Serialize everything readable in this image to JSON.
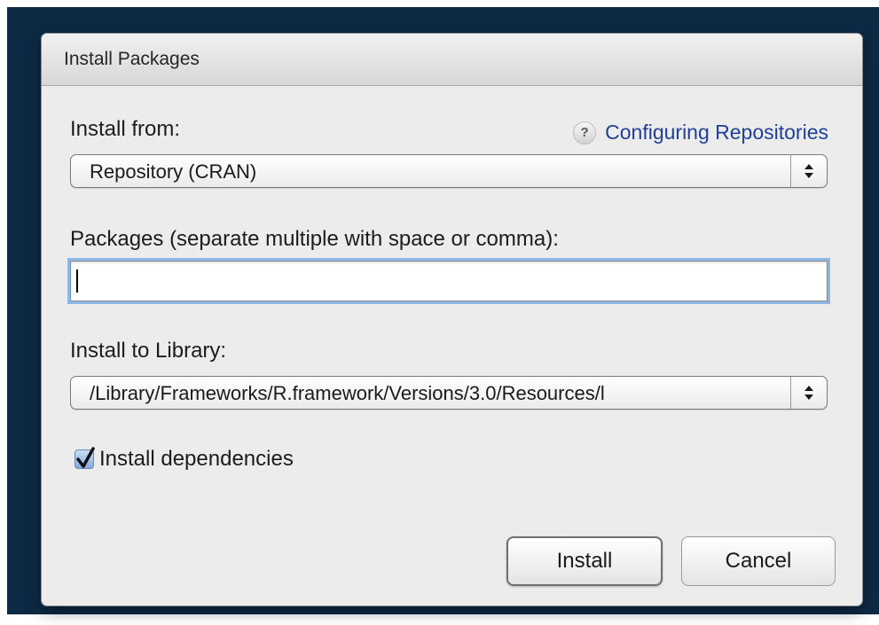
{
  "dialog": {
    "title": "Install Packages"
  },
  "install_from": {
    "label": "Install from:",
    "help_icon_glyph": "?",
    "help_link": "Configuring Repositories",
    "selected": "Repository (CRAN)"
  },
  "packages": {
    "label": "Packages (separate multiple with space or comma):",
    "value": ""
  },
  "library": {
    "label": "Install to Library:",
    "selected": "/Library/Frameworks/R.framework/Versions/3.0/Resources/l"
  },
  "dependencies": {
    "label": "Install dependencies",
    "checked": true
  },
  "buttons": {
    "install": "Install",
    "cancel": "Cancel"
  },
  "colors": {
    "link": "#1f3f9a",
    "focus_ring": "#8db7e6",
    "backdrop": "#0d2a45"
  },
  "icons": {
    "help": "help-icon",
    "select_arrows": "updown-arrows-icon",
    "checkmark": "checkmark-icon"
  }
}
